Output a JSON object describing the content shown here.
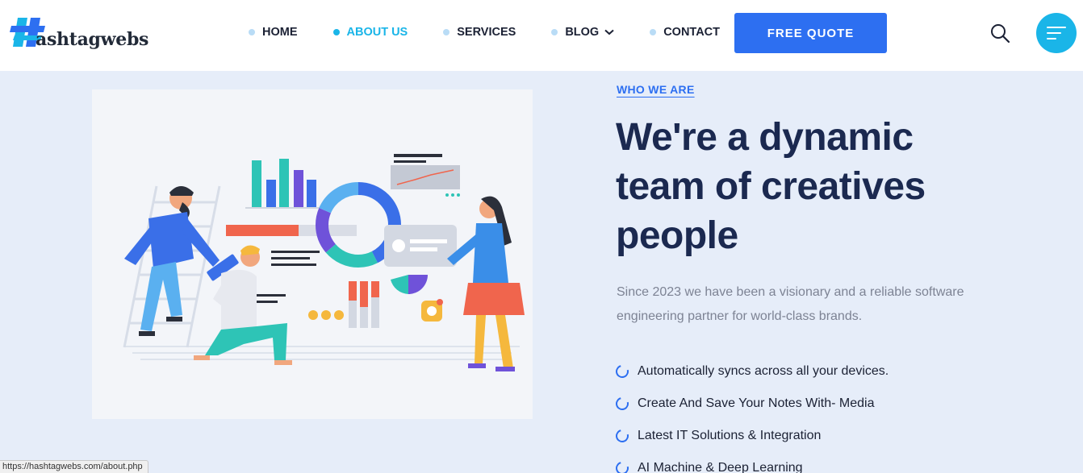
{
  "brand": {
    "name": "ashtagwebs",
    "colors": {
      "primary": "#2d6ff1",
      "accent": "#1ab5e8",
      "heading": "#1b2950"
    }
  },
  "nav": {
    "items": [
      {
        "label": "HOME",
        "active": false
      },
      {
        "label": "ABOUT US",
        "active": true
      },
      {
        "label": "SERVICES",
        "active": false
      },
      {
        "label": "BLOG",
        "active": false,
        "has_dropdown": true
      },
      {
        "label": "CONTACT",
        "active": false
      }
    ],
    "cta_label": "FREE QUOTE",
    "search_icon": "search-icon",
    "menu_icon": "hamburger-menu-icon"
  },
  "about": {
    "eyebrow": "WHO WE ARE",
    "headline": "We're a dynamic team of creatives people",
    "description": "Since 2023 we have been a visionary and a reliable software engineering partner for world-class brands.",
    "features": [
      "Automatically syncs across all your devices.",
      "Create And Save Your Notes With- Media",
      "Latest IT Solutions & Integration",
      "AI Machine & Deep Learning"
    ]
  },
  "status_url": "https://hashtagwebs.com/about.php"
}
